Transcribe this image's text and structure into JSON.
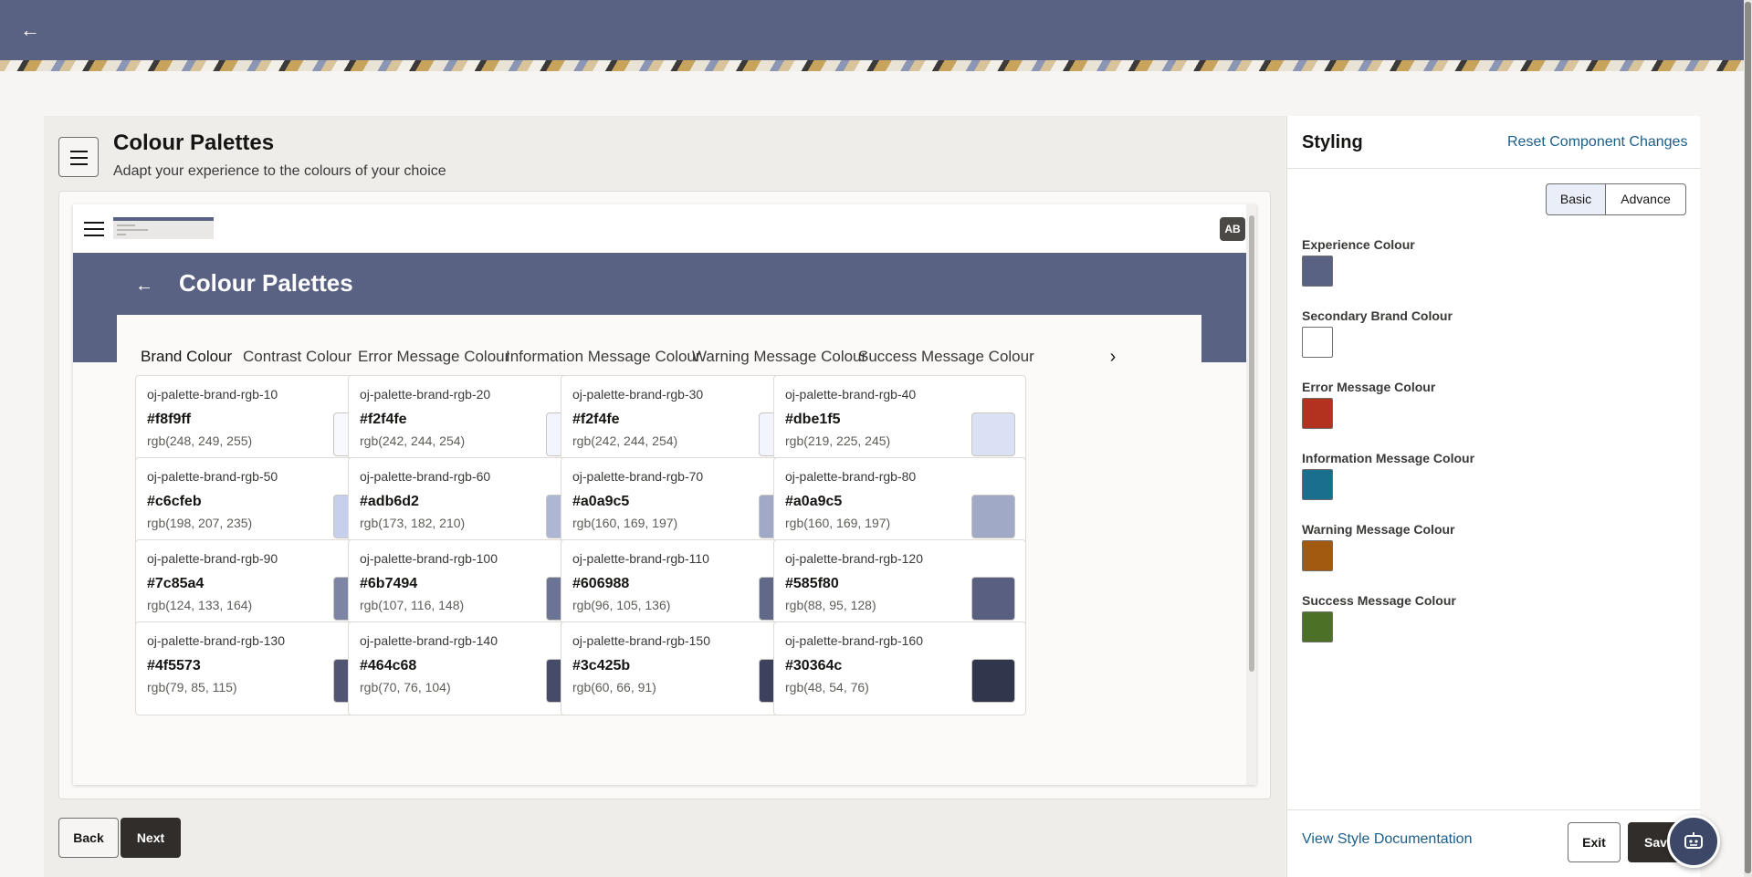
{
  "topbar": {
    "back_icon": "arrow-left-icon"
  },
  "header": {
    "title": "Colour Palettes",
    "subtitle": "Adapt your experience to the colours of your choice"
  },
  "preview": {
    "avatar": "AB",
    "title": "Colour Palettes",
    "tabs": [
      "Brand Colour",
      "Contrast Colour",
      "Error Message Colour",
      "Information Message Colour",
      "Warning Message Colour",
      "Success Message Colour"
    ],
    "cards": [
      {
        "name": "oj-palette-brand-rgb-10",
        "hex": "#f8f9ff",
        "rgb": "rgb(248, 249, 255)",
        "swatch": "#f8f9ff"
      },
      {
        "name": "oj-palette-brand-rgb-20",
        "hex": "#f2f4fe",
        "rgb": "rgb(242, 244, 254)",
        "swatch": "#f2f4fe"
      },
      {
        "name": "oj-palette-brand-rgb-30",
        "hex": "#f2f4fe",
        "rgb": "rgb(242, 244, 254)",
        "swatch": "#f2f4fe"
      },
      {
        "name": "oj-palette-brand-rgb-40",
        "hex": "#dbe1f5",
        "rgb": "rgb(219, 225, 245)",
        "swatch": "#dbe1f5"
      },
      {
        "name": "oj-palette-brand-rgb-50",
        "hex": "#c6cfeb",
        "rgb": "rgb(198, 207, 235)",
        "swatch": "#c6cfeb"
      },
      {
        "name": "oj-palette-brand-rgb-60",
        "hex": "#adb6d2",
        "rgb": "rgb(173, 182, 210)",
        "swatch": "#adb6d2"
      },
      {
        "name": "oj-palette-brand-rgb-70",
        "hex": "#a0a9c5",
        "rgb": "rgb(160, 169, 197)",
        "swatch": "#a0a9c5"
      },
      {
        "name": "oj-palette-brand-rgb-80",
        "hex": "#a0a9c5",
        "rgb": "rgb(160, 169, 197)",
        "swatch": "#a0a9c5"
      },
      {
        "name": "oj-palette-brand-rgb-90",
        "hex": "#7c85a4",
        "rgb": "rgb(124, 133, 164)",
        "swatch": "#7c85a4"
      },
      {
        "name": "oj-palette-brand-rgb-100",
        "hex": "#6b7494",
        "rgb": "rgb(107, 116, 148)",
        "swatch": "#6b7494"
      },
      {
        "name": "oj-palette-brand-rgb-110",
        "hex": "#606988",
        "rgb": "rgb(96, 105, 136)",
        "swatch": "#606988"
      },
      {
        "name": "oj-palette-brand-rgb-120",
        "hex": "#585f80",
        "rgb": "rgb(88, 95, 128)",
        "swatch": "#585f80"
      },
      {
        "name": "oj-palette-brand-rgb-130",
        "hex": "#4f5573",
        "rgb": "rgb(79, 85, 115)",
        "swatch": "#4f5573"
      },
      {
        "name": "oj-palette-brand-rgb-140",
        "hex": "#464c68",
        "rgb": "rgb(70, 76, 104)",
        "swatch": "#464c68"
      },
      {
        "name": "oj-palette-brand-rgb-150",
        "hex": "#3c425b",
        "rgb": "rgb(60, 66, 91)",
        "swatch": "#3c425b"
      },
      {
        "name": "oj-palette-brand-rgb-160",
        "hex": "#30364c",
        "rgb": "rgb(48, 54, 76)",
        "swatch": "#30364c"
      }
    ]
  },
  "actions": {
    "back": "Back",
    "next": "Next"
  },
  "panel": {
    "title": "Styling",
    "reset": "Reset Component Changes",
    "mode_basic": "Basic",
    "mode_advance": "Advance",
    "colors": [
      {
        "label": "Experience Colour",
        "value": "#5a6284"
      },
      {
        "label": "Secondary Brand Colour",
        "value": "#ffffff"
      },
      {
        "label": "Error Message Colour",
        "value": "#b3311f"
      },
      {
        "label": "Information Message Colour",
        "value": "#1a6e8e"
      },
      {
        "label": "Warning Message Colour",
        "value": "#a15a10"
      },
      {
        "label": "Success Message Colour",
        "value": "#4b7026"
      }
    ],
    "doc_link": "View Style Documentation",
    "exit": "Exit",
    "save": "Save"
  },
  "accent_color": "#5a6284"
}
